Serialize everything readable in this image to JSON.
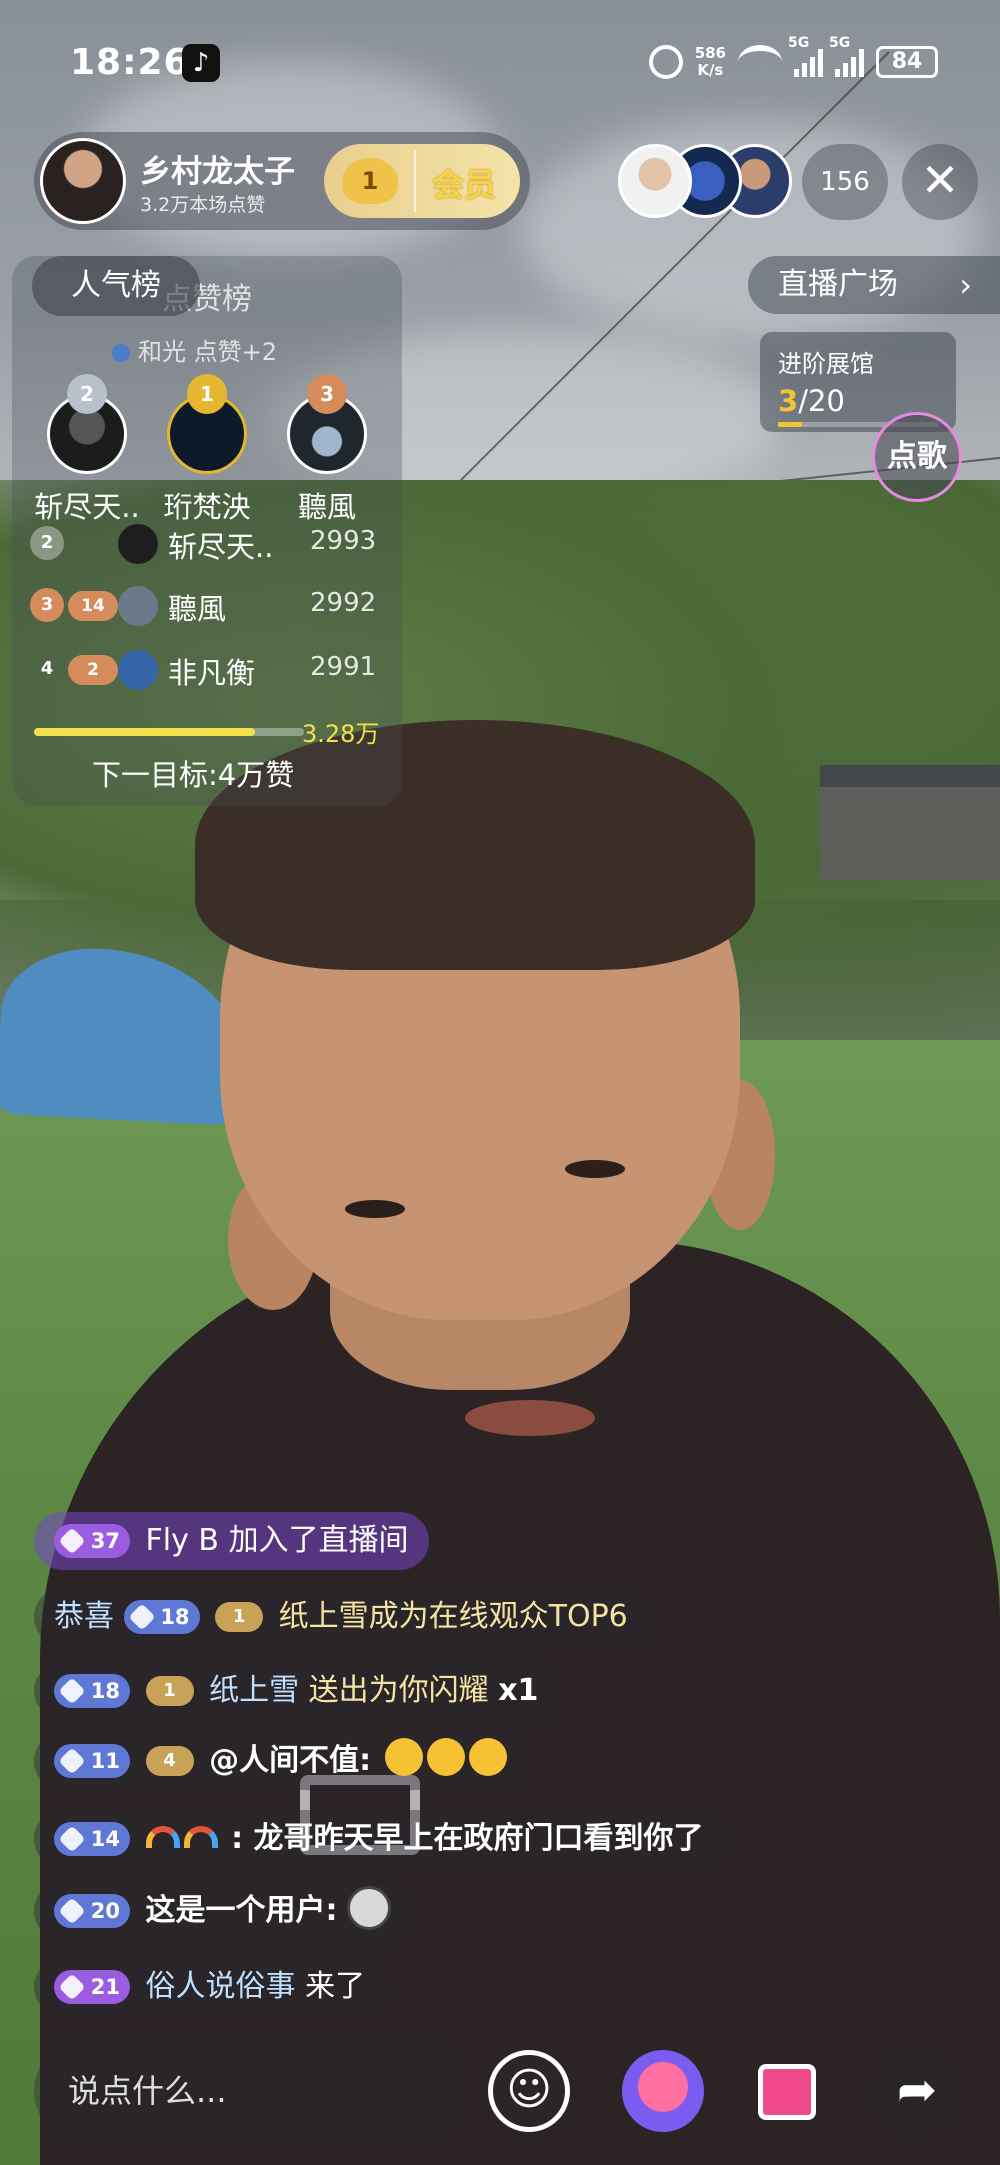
{
  "status_bar": {
    "time": "18:26",
    "net_speed_value": "586",
    "net_speed_unit": "K/s",
    "signal1_label": "5G",
    "signal2_label": "5G",
    "battery": "84"
  },
  "host": {
    "name": "乡村龙太子",
    "likes": "3.2万本场点赞",
    "member_level": "1",
    "member_label": "会员"
  },
  "viewers": {
    "count": "156",
    "close_symbol": "✕"
  },
  "ranking": {
    "tab_active": "人气榜",
    "tab_inactive": "点赞榜",
    "notice": "和光  点赞+2",
    "podium": [
      {
        "rank": "2",
        "name": "斩尽天..",
        "medal_color": "#b8c0cc"
      },
      {
        "rank": "1",
        "name": "珩梵泱",
        "medal_color": "#e5b730"
      },
      {
        "rank": "3",
        "name": "聽風",
        "medal_color": "#d58b5a"
      }
    ],
    "rows": [
      {
        "rank": "2",
        "level": "",
        "name": "斩尽天..",
        "score": "2993"
      },
      {
        "rank": "3",
        "level": "14",
        "name": "聽風",
        "score": "2992"
      },
      {
        "rank": "4",
        "level": "2",
        "name": "非凡衡",
        "score": "2991"
      }
    ],
    "progress_fraction": 0.82,
    "progress_value": "3.28万",
    "next_target": "下一目标:4万赞"
  },
  "right_panel": {
    "plaza_label": "直播广场",
    "plaza_arrow": "›",
    "advance_title": "进阶展馆",
    "advance_current": "3",
    "advance_total": "/20",
    "advance_fraction": 0.15,
    "song_label": "点歌"
  },
  "chat": [
    {
      "type": "join",
      "level": "37",
      "name": "Fly B",
      "text": "加入了直播间"
    },
    {
      "type": "congrats",
      "prefix": "恭喜",
      "level": "18",
      "fan": "1",
      "text": "纸上雪成为在线观众TOP6"
    },
    {
      "type": "gift",
      "level": "18",
      "fan": "1",
      "name": "纸上雪",
      "text": "送出为你闪耀",
      "count": "x1"
    },
    {
      "type": "msg",
      "level": "11",
      "fan": "4",
      "text": "@人间不值:"
    },
    {
      "type": "msg",
      "level": "14",
      "text": ":  龙哥昨天早上在政府门口看到你了"
    },
    {
      "type": "msg",
      "level": "20",
      "text": "这是一个用户:"
    },
    {
      "type": "join2",
      "level": "21",
      "name": "俗人说俗事",
      "text": "来了"
    }
  ],
  "bottom": {
    "input_placeholder": "说点什么...",
    "smile_icon": "☺",
    "share_icon": "➦"
  }
}
